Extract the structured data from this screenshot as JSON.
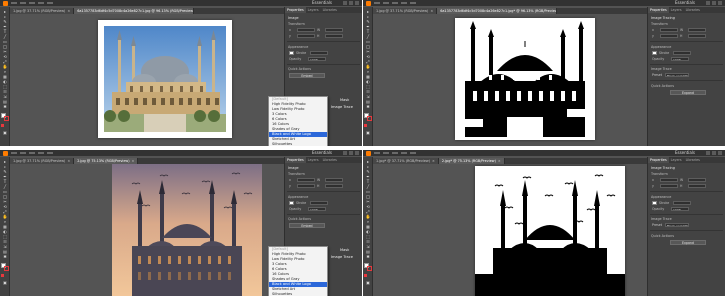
{
  "app": {
    "workspace_label": "Essentials",
    "menu_items": [
      "",
      "",
      "",
      "",
      ""
    ]
  },
  "colors": {
    "app_background": "#535353",
    "title_bar": "#323232",
    "panel_background": "#434343",
    "toolbar_background": "#424242",
    "selection_blue": "#2b67d9",
    "stroke_red": "#e8383d",
    "illustrator_orange": "#ff7c00"
  },
  "quadrants": [
    {
      "id": "q1",
      "tabs": [
        {
          "label": "1.jpg @ 37.71% (RGB/Preview)",
          "active": false
        },
        {
          "label": "6a1357783d6df4c5d7008c4a26e827c1.jpg @ 96.13% (RGB/Preview)",
          "active": true
        }
      ],
      "panel": {
        "tabs": [
          "Properties",
          "Layers",
          "Libraries"
        ],
        "section_image": "Image",
        "transform_label": "Transform",
        "x": "x",
        "y": "y",
        "w": "W",
        "h": "H",
        "x_val": "",
        "y_val": "",
        "w_val": "",
        "h_val": "",
        "appearance_label": "Appearance",
        "stroke_label": "Stroke",
        "opacity_label": "Opacity",
        "opacity_val": "100%",
        "quick_actions_label": "Quick Actions",
        "image_trace_label": "Image Trace",
        "embed_label": "Embed",
        "preset_label": "Preset",
        "preset_value": "",
        "expand_label": "Expand"
      },
      "dropdown": {
        "items": [
          "[Default]",
          "High Fidelity Photo",
          "Low Fidelity Photo",
          "3 Colors",
          "6 Colors",
          "16 Colors",
          "Shades of Gray",
          "Black and White Logo",
          "Sketched Art",
          "Silhouettes"
        ],
        "selected_index": 7
      },
      "side_labels": [
        "Mask",
        "Image Trace"
      ]
    },
    {
      "id": "q2",
      "tabs": [
        {
          "label": "1.jpg @ 37.71% (RGB/Preview)",
          "active": false
        },
        {
          "label": "6a1357783d6df4c5d7008c4a26e827c1.jpg* @ 96.13% (RGB/Preview)",
          "active": true
        }
      ],
      "panel": {
        "tabs": [
          "Properties",
          "Layers",
          "Libraries"
        ],
        "section_image": "Image Tracing",
        "transform_label": "Transform",
        "x": "x",
        "y": "y",
        "w": "W",
        "h": "H",
        "x_val": "",
        "y_val": "",
        "w_val": "",
        "h_val": "",
        "appearance_label": "Appearance",
        "stroke_label": "Stroke",
        "opacity_label": "Opacity",
        "opacity_val": "100%",
        "quick_actions_label": "Quick Actions",
        "image_trace_label": "Image Trace",
        "embed_label": "",
        "preset_label": "Preset",
        "preset_value": "Black and White...",
        "expand_label": "Expand"
      },
      "dropdown": null,
      "side_labels": []
    },
    {
      "id": "q3",
      "tabs": [
        {
          "label": "1.jpg @ 37.71% (RGB/Preview)",
          "active": false
        },
        {
          "label": "2.jpg @ 75.13% (RGB/Preview)",
          "active": true
        }
      ],
      "panel": {
        "tabs": [
          "Properties",
          "Layers",
          "Libraries"
        ],
        "section_image": "Image",
        "transform_label": "Transform",
        "x": "x",
        "y": "y",
        "w": "W",
        "h": "H",
        "x_val": "",
        "y_val": "",
        "w_val": "",
        "h_val": "",
        "appearance_label": "Appearance",
        "stroke_label": "Stroke",
        "opacity_label": "Opacity",
        "opacity_val": "100%",
        "quick_actions_label": "Quick Actions",
        "image_trace_label": "Image Trace",
        "embed_label": "Embed",
        "preset_label": "Preset",
        "preset_value": "",
        "expand_label": "Expand"
      },
      "dropdown": {
        "items": [
          "[Default]",
          "High Fidelity Photo",
          "Low Fidelity Photo",
          "3 Colors",
          "6 Colors",
          "16 Colors",
          "Shades of Gray",
          "Black and White Logo",
          "Sketched Art",
          "Silhouettes"
        ],
        "selected_index": 7
      },
      "side_labels": [
        "Mask",
        "Image Trace"
      ]
    },
    {
      "id": "q4",
      "tabs": [
        {
          "label": "1.jpg* @ 37.71% (RGB/Preview)",
          "active": false
        },
        {
          "label": "2.jpg* @ 75.13% (RGB/Preview)",
          "active": true
        }
      ],
      "panel": {
        "tabs": [
          "Properties",
          "Layers",
          "Libraries"
        ],
        "section_image": "Image Tracing",
        "transform_label": "Transform",
        "x": "x",
        "y": "y",
        "w": "W",
        "h": "H",
        "x_val": "",
        "y_val": "",
        "w_val": "",
        "h_val": "",
        "appearance_label": "Appearance",
        "stroke_label": "Stroke",
        "opacity_label": "Opacity",
        "opacity_val": "100%",
        "quick_actions_label": "Quick Actions",
        "image_trace_label": "Image Trace",
        "embed_label": "",
        "preset_label": "Preset",
        "preset_value": "Black and White...",
        "expand_label": "Expand"
      },
      "dropdown": null,
      "side_labels": []
    }
  ]
}
